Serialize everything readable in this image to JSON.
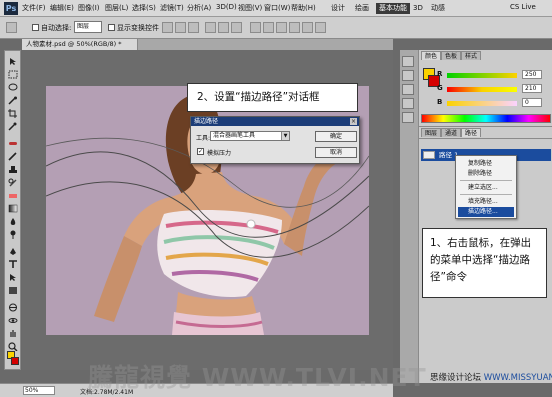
{
  "menubar": {
    "logo": "Ps",
    "menus": [
      "文件(F)",
      "编辑(E)",
      "图像(I)",
      "图层(L)",
      "选择(S)",
      "滤镜(T)",
      "分析(A)",
      "3D(D)",
      "视图(V)",
      "窗口(W)",
      "帮助(H)"
    ],
    "zoom": "50%",
    "workspaces": [
      "设计",
      "绘画",
      "基本功能",
      "3D",
      "动感"
    ],
    "active_workspace": "基本功能",
    "cs_live": "CS Live"
  },
  "options": {
    "auto_select_label": "自动选择:",
    "auto_select_value": "图层",
    "show_transform_label": "显示变换控件"
  },
  "document": {
    "tab_title": "人物素材.psd @ 50%(RGB/8) *"
  },
  "status": {
    "zoom": "50%",
    "doc_size": "文档:2.78M/2.41M"
  },
  "color_panel": {
    "tabs": [
      "颜色",
      "色板",
      "样式"
    ],
    "sliders": [
      {
        "label": "R",
        "value": "250"
      },
      {
        "label": "G",
        "value": "210"
      },
      {
        "label": "B",
        "value": "0"
      }
    ],
    "foreground": "#fad200"
  },
  "paths_panel": {
    "tabs": [
      "图层",
      "通道",
      "路径"
    ],
    "path_name": "路径 1"
  },
  "context_menu": {
    "items": [
      "复制路径",
      "删除路径",
      "建立选区...",
      "填充路径...",
      "描边路径..."
    ],
    "highlighted": "描边路径..."
  },
  "dialog": {
    "title": "描边路径",
    "tool_label": "工具:",
    "tool_value": "混合器画笔工具",
    "simulate_pressure": "模拟压力",
    "ok": "确定",
    "cancel": "取消"
  },
  "callouts": {
    "step2": "2、设置“描边路径”对话框",
    "step1": "1、右击鼠标，在弹出的菜单中选择“描边路径”命令"
  },
  "watermark": "騰龍視覺 WWW.TLVI.NET",
  "credit": {
    "prefix": "思缘设计论坛 ",
    "url": "WWW.MISSYUAN.COM"
  }
}
